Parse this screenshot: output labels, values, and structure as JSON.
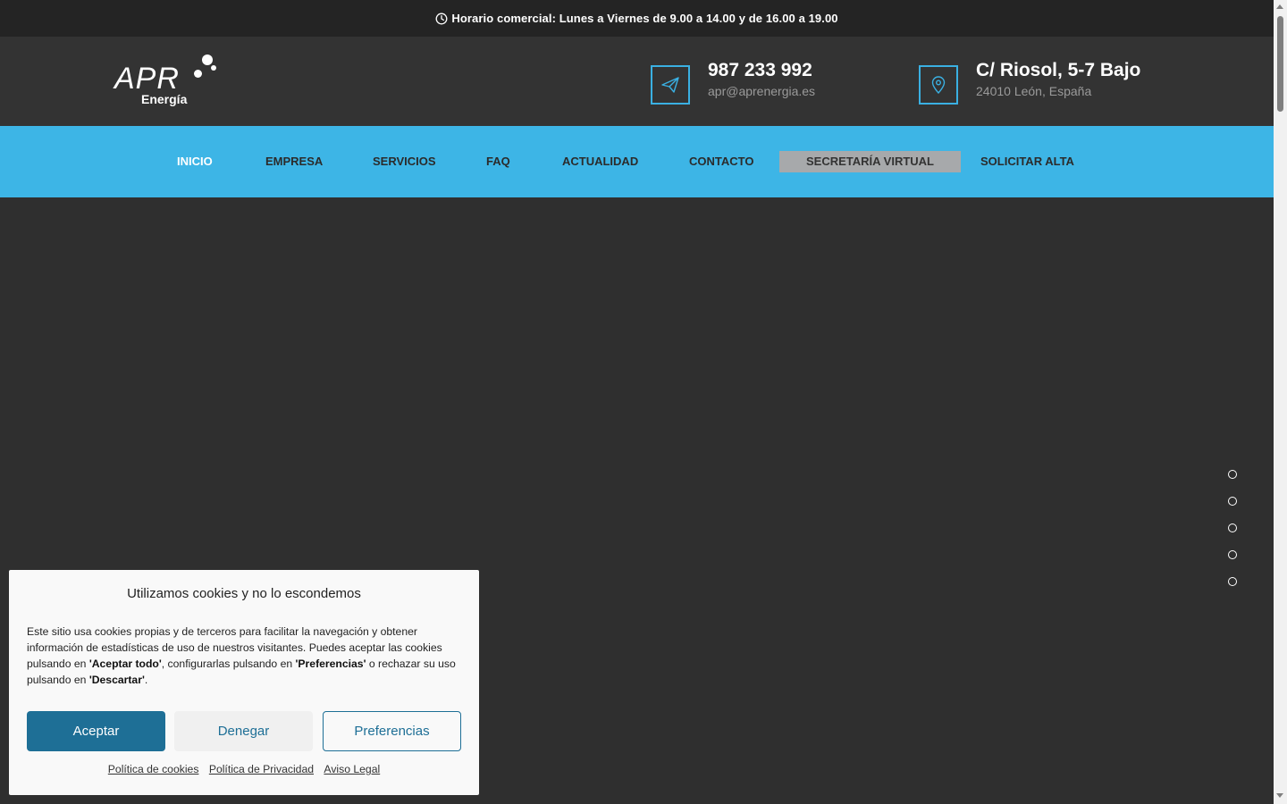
{
  "topbar": {
    "hours": "Horario comercial: Lunes a Viernes de 9.00 a 14.00 y de 16.00 a 19.00",
    "icon": "clock-icon"
  },
  "header": {
    "logo": {
      "word": "APR",
      "sub": "Energía"
    },
    "phone": {
      "number": "987 233 992",
      "email": "apr@aprenergia.es",
      "icon": "paper-plane-icon"
    },
    "address": {
      "line1": "C/ Riosol, 5-7 Bajo",
      "line2": "24010 León, España",
      "icon": "location-pin-icon"
    }
  },
  "nav": {
    "items": [
      {
        "label": "INICIO"
      },
      {
        "label": "EMPRESA"
      },
      {
        "label": "SERVICIOS"
      },
      {
        "label": "FAQ"
      },
      {
        "label": "ACTUALIDAD"
      },
      {
        "label": "CONTACTO"
      },
      {
        "label": "SECRETARÍA VIRTUAL"
      },
      {
        "label": "SOLICITAR ALTA"
      }
    ],
    "active_index": 0
  },
  "slider": {
    "dots": 5
  },
  "cookie": {
    "title": "Utilizamos cookies y no lo escondemos",
    "text_part1": "Este sitio usa cookies propias y de terceros para facilitar la navegación y obtener información de estadísticas de uso de nuestros visitantes. Puedes aceptar las cookies pulsando en ",
    "accept_quoted": "'Aceptar todo'",
    "text_part2": ", configurarlas pulsando en ",
    "prefs_quoted": "'Preferencias'",
    "text_part3": " o rechazar su uso pulsando en ",
    "deny_quoted": "'Descartar'",
    "text_part4": ".",
    "buttons": {
      "accept": "Aceptar",
      "deny": "Denegar",
      "prefs": "Preferencias"
    },
    "links": {
      "cookies": "Política de cookies",
      "privacy": "Política de Privacidad",
      "legal": "Aviso Legal"
    }
  },
  "colors": {
    "accent": "#3db5e6",
    "topbar_bg": "#242424",
    "header_bg": "#333333",
    "hero_bg": "#2f2f2f",
    "button_primary": "#1e6f96"
  }
}
